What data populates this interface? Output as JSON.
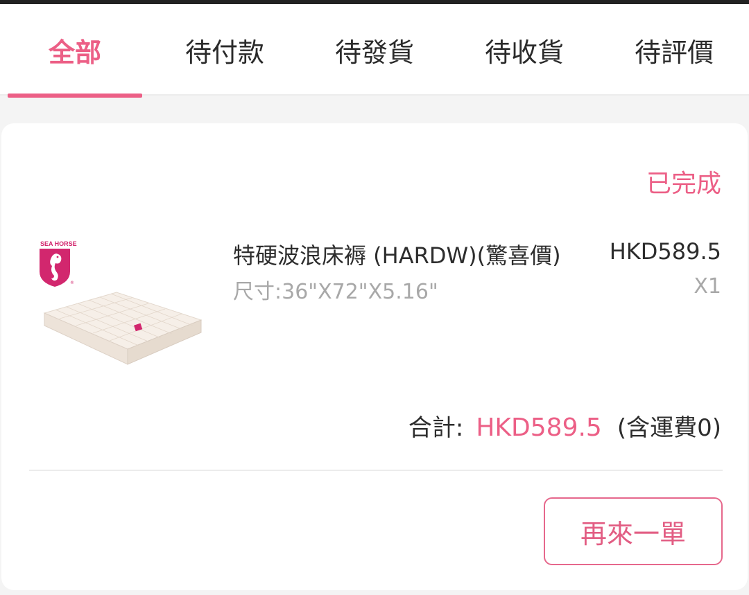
{
  "tabs": [
    {
      "label": "全部",
      "active": true
    },
    {
      "label": "待付款",
      "active": false
    },
    {
      "label": "待發貨",
      "active": false
    },
    {
      "label": "待收貨",
      "active": false
    },
    {
      "label": "待評價",
      "active": false
    }
  ],
  "order": {
    "status": "已完成",
    "product": {
      "brand_logo_text": "SEA HORSE",
      "image_icon": "mattress-image",
      "title": "特硬波浪床褥 (HARDW)(驚喜價)",
      "price": "HKD589.5",
      "spec": "尺寸:36\"X72\"X5.16\"",
      "quantity": "X1"
    },
    "total_label": "合計:",
    "total_amount": "HKD589.5",
    "shipping_note": "(含運費0)",
    "reorder_label": "再來一單"
  },
  "colors": {
    "accent": "#ec5f86",
    "text": "#2d2d2d",
    "muted": "#a8a8a8",
    "background": "#f4f4f4"
  }
}
